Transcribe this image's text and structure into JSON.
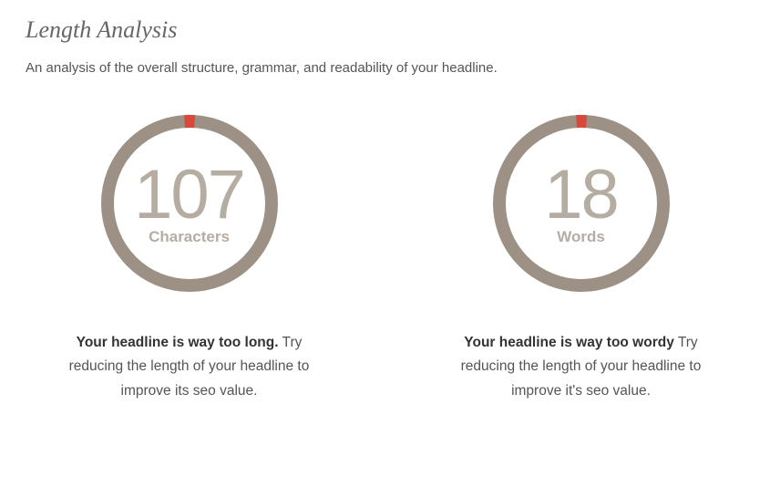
{
  "header": {
    "title": "Length Analysis",
    "subtitle": "An analysis of the overall structure, grammar, and readability of your headline."
  },
  "metrics": [
    {
      "value": "107",
      "label": "Characters",
      "feedback_bold": "Your headline is way too long.",
      "feedback_rest": " Try reducing the length of your headline to improve its seo value.",
      "indicator_fraction": 0.02
    },
    {
      "value": "18",
      "label": "Words",
      "feedback_bold": "Your headline is way too wordy",
      "feedback_rest": " Try reducing the length of your headline to improve it's seo value.",
      "indicator_fraction": 0.02
    }
  ],
  "colors": {
    "ring": "#9c9184",
    "indicator": "#d9483b",
    "text_muted": "#b5ada1"
  },
  "chart_data": [
    {
      "type": "pie",
      "title": "Characters",
      "categories": [
        "indicator",
        "ring"
      ],
      "values": [
        0.02,
        0.98
      ],
      "center_value": 107,
      "center_label": "Characters"
    },
    {
      "type": "pie",
      "title": "Words",
      "categories": [
        "indicator",
        "ring"
      ],
      "values": [
        0.02,
        0.98
      ],
      "center_value": 18,
      "center_label": "Words"
    }
  ]
}
